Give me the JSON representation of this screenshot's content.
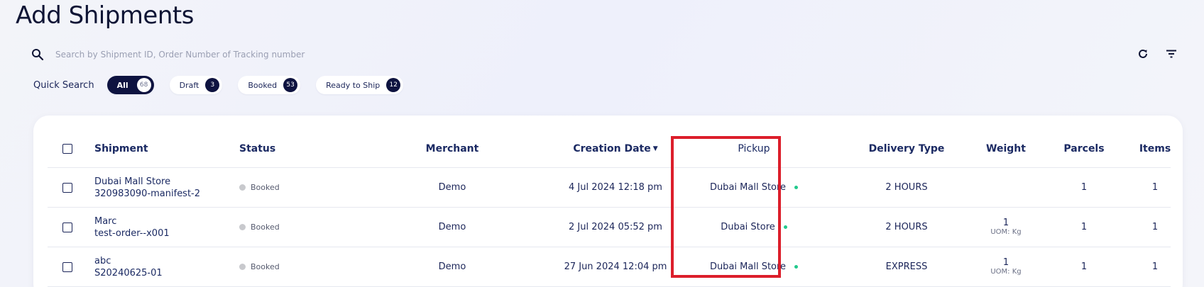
{
  "page": {
    "title": "Add Shipments"
  },
  "search": {
    "placeholder": "Search by Shipment ID, Order Number of Tracking number",
    "value": ""
  },
  "quick_search": {
    "label": "Quick Search",
    "chips": [
      {
        "label": "All",
        "count": "68",
        "active": true
      },
      {
        "label": "Draft",
        "count": "3",
        "active": false
      },
      {
        "label": "Booked",
        "count": "53",
        "active": false
      },
      {
        "label": "Ready to Ship",
        "count": "12",
        "active": false
      }
    ]
  },
  "icons": {
    "search": "search-icon",
    "refresh": "refresh-icon",
    "filter": "filter-icon"
  },
  "table": {
    "headers": {
      "shipment": "Shipment",
      "status": "Status",
      "merchant": "Merchant",
      "creation_date": "Creation Date",
      "pickup": "Pickup",
      "delivery_type": "Delivery Type",
      "weight": "Weight",
      "parcels": "Parcels",
      "items": "Items"
    },
    "rows": [
      {
        "name": "Dubai Mall Store",
        "id": "320983090-manifest-2",
        "status": "Booked",
        "merchant": "Demo",
        "date": "4 Jul 2024 12:18 pm",
        "pickup": "Dubai Mall Store",
        "delivery": "2 HOURS",
        "weight": "",
        "uom": "",
        "parcels": "1",
        "items": "1"
      },
      {
        "name": "Marc",
        "id": "test-order--x001",
        "status": "Booked",
        "merchant": "Demo",
        "date": "2 Jul 2024 05:52 pm",
        "pickup": "Dubai Store",
        "delivery": "2 HOURS",
        "weight": "1",
        "uom": "UOM: Kg",
        "parcels": "1",
        "items": "1"
      },
      {
        "name": "abc",
        "id": "S20240625-01",
        "status": "Booked",
        "merchant": "Demo",
        "date": "27 Jun 2024 12:04 pm",
        "pickup": "Dubai Mall Store",
        "delivery": "EXPRESS",
        "weight": "1",
        "uom": "UOM: Kg",
        "parcels": "1",
        "items": "1"
      }
    ]
  },
  "colors": {
    "accent": "#0e1340",
    "highlight": "#dc1e2b",
    "pickup_dot": "#22c98c",
    "status_dot": "#c8c9cd"
  }
}
